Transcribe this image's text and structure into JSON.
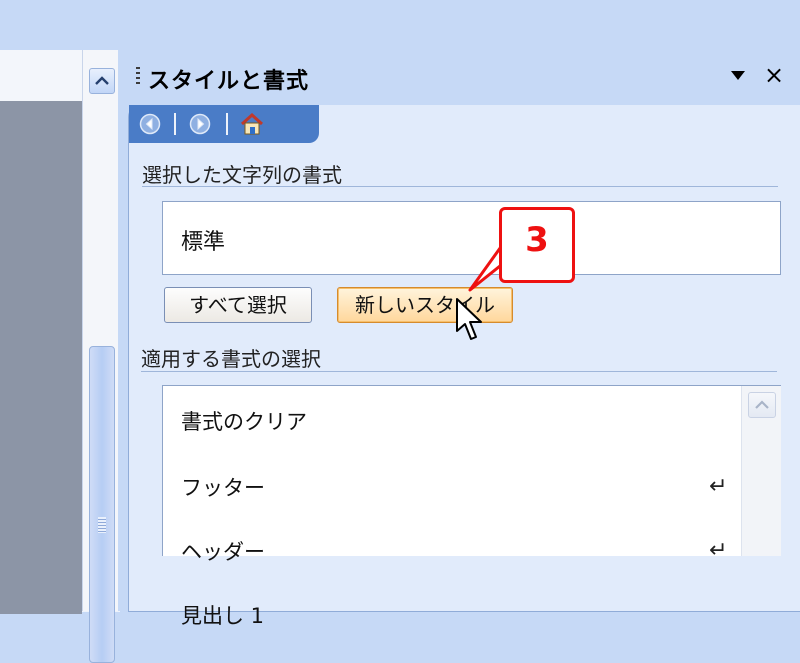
{
  "pane": {
    "title": "スタイルと書式",
    "close_glyph": "×",
    "nav": {
      "back": "back-arrow-icon",
      "forward": "forward-arrow-icon",
      "home": "home-icon"
    }
  },
  "selected_section": {
    "label": "選択した文字列の書式",
    "current_style": "標準"
  },
  "buttons": {
    "select_all": "すべて選択",
    "new_style": "新しいスタイル"
  },
  "apply_section": {
    "label": "適用する書式の選択",
    "items": [
      {
        "label": "書式のクリア",
        "mark": ""
      },
      {
        "label": "フッター",
        "mark": "↵"
      },
      {
        "label": "ヘッダー",
        "mark": "↵"
      },
      {
        "label": "見出し 1",
        "mark": ""
      }
    ]
  },
  "callout": {
    "number": "3",
    "color": "#ee1111"
  },
  "colors": {
    "pane_bg": "#c6d9f6",
    "nav_blue": "#4a7cc7",
    "hover_orange": "#ffd79c"
  }
}
